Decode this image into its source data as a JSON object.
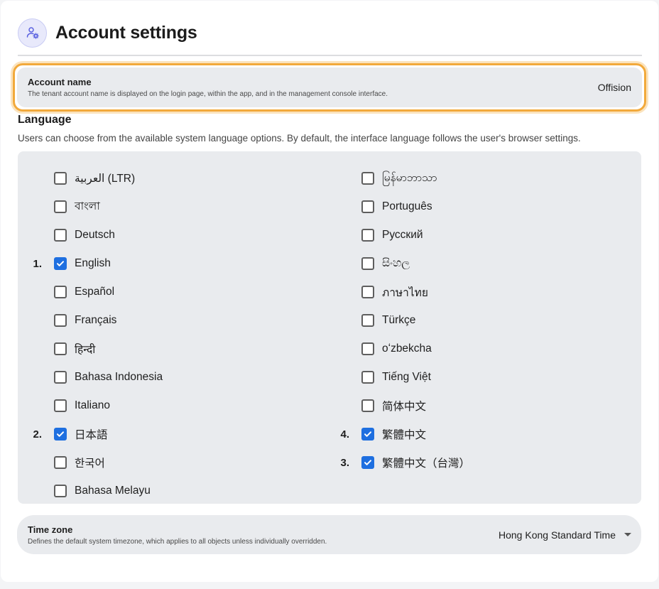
{
  "header": {
    "title": "Account settings",
    "icon": "user-settings-icon",
    "icon_color": "#5b62e0"
  },
  "account_name": {
    "title": "Account name",
    "description": "The tenant account name is displayed on the login page, within the app, and in the management console interface.",
    "value": "Offision",
    "highlight_color": "#f2a93b"
  },
  "language": {
    "title": "Language",
    "description": "Users can choose from the available system language options. By default, the interface language follows the user's browser settings.",
    "left_column": [
      {
        "label": "العربية (LTR)",
        "checked": false,
        "order": ""
      },
      {
        "label": "বাংলা",
        "checked": false,
        "order": ""
      },
      {
        "label": "Deutsch",
        "checked": false,
        "order": ""
      },
      {
        "label": "English",
        "checked": true,
        "order": "1."
      },
      {
        "label": "Español",
        "checked": false,
        "order": ""
      },
      {
        "label": "Français",
        "checked": false,
        "order": ""
      },
      {
        "label": "हिन्दी",
        "checked": false,
        "order": ""
      },
      {
        "label": "Bahasa Indonesia",
        "checked": false,
        "order": ""
      },
      {
        "label": "Italiano",
        "checked": false,
        "order": ""
      },
      {
        "label": "日本語",
        "checked": true,
        "order": "2."
      },
      {
        "label": "한국어",
        "checked": false,
        "order": ""
      },
      {
        "label": "Bahasa Melayu",
        "checked": false,
        "order": ""
      }
    ],
    "right_column": [
      {
        "label": "မြန်မာဘာသာ",
        "checked": false,
        "order": ""
      },
      {
        "label": "Português",
        "checked": false,
        "order": ""
      },
      {
        "label": "Русский",
        "checked": false,
        "order": ""
      },
      {
        "label": "සිංහල",
        "checked": false,
        "order": ""
      },
      {
        "label": "ภาษาไทย",
        "checked": false,
        "order": ""
      },
      {
        "label": "Türkçe",
        "checked": false,
        "order": ""
      },
      {
        "label": "oʻzbekcha",
        "checked": false,
        "order": ""
      },
      {
        "label": "Tiếng Việt",
        "checked": false,
        "order": ""
      },
      {
        "label": "简体中文",
        "checked": false,
        "order": ""
      },
      {
        "label": "繁體中文",
        "checked": true,
        "order": "4."
      },
      {
        "label": "繁體中文（台灣）",
        "checked": true,
        "order": "3."
      }
    ],
    "checkbox_color": "#1e6fe0"
  },
  "timezone": {
    "title": "Time zone",
    "description": "Defines the default system timezone, which applies to all objects unless individually overridden.",
    "value": "Hong Kong Standard Time",
    "dropdown_icon": "caret-down-icon"
  }
}
